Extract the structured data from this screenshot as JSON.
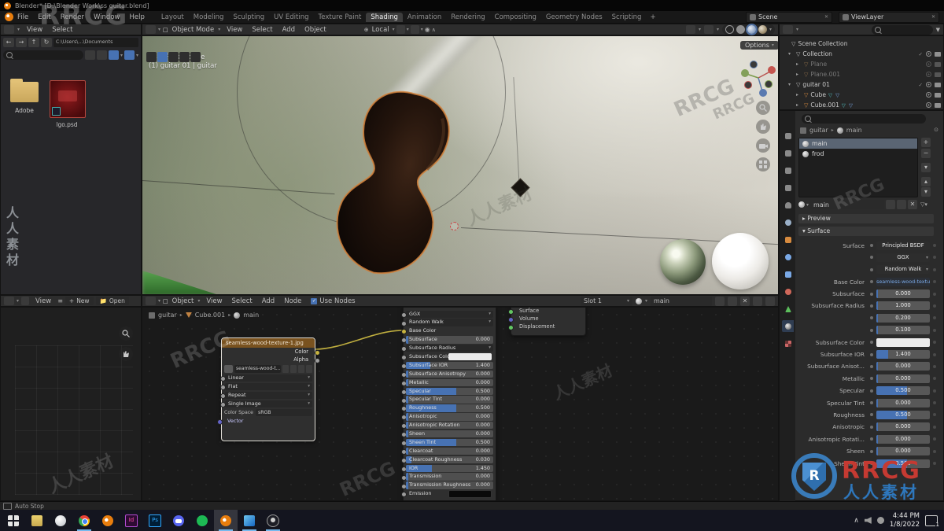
{
  "titlebar": {
    "title": "Blender* [D:\\Blender Work\\ss guitar.blend]"
  },
  "topbar": {
    "menus": [
      {
        "label": "File"
      },
      {
        "label": "Edit"
      },
      {
        "label": "Render"
      },
      {
        "label": "Window"
      },
      {
        "label": "Help"
      }
    ],
    "workspaces": [
      {
        "label": "Layout",
        "cls": ""
      },
      {
        "label": "Modeling",
        "cls": ""
      },
      {
        "label": "Sculpting",
        "cls": ""
      },
      {
        "label": "UV Editing",
        "cls": ""
      },
      {
        "label": "Texture Paint",
        "cls": ""
      },
      {
        "label": "Shading",
        "cls": "active"
      },
      {
        "label": "Animation",
        "cls": ""
      },
      {
        "label": "Rendering",
        "cls": ""
      },
      {
        "label": "Compositing",
        "cls": ""
      },
      {
        "label": "Geometry Nodes",
        "cls": ""
      },
      {
        "label": "Scripting",
        "cls": ""
      }
    ],
    "new_workspace": "+",
    "scene": "Scene",
    "view_layer": "ViewLayer"
  },
  "file_browser": {
    "menus": [
      {
        "label": "View"
      },
      {
        "label": "Select"
      }
    ],
    "path": "C:\\Users\\...\\Documents",
    "items": [
      {
        "label": "Adobe"
      },
      {
        "label": "lgo.psd"
      }
    ]
  },
  "image_editor": {
    "view": "View",
    "new_button": "New",
    "open_button": "Open"
  },
  "viewport": {
    "mode": "Object Mode",
    "menus": [
      {
        "label": "View"
      },
      {
        "label": "Select"
      },
      {
        "label": "Add"
      },
      {
        "label": "Object"
      }
    ],
    "orientation": "Local",
    "persp": "User Perspective",
    "object_info": "(1) guitar 01 | guitar",
    "options": "Options"
  },
  "shader_editor": {
    "type": "Object",
    "menus": [
      {
        "label": "View"
      },
      {
        "label": "Select"
      },
      {
        "label": "Add"
      },
      {
        "label": "Node"
      }
    ],
    "use_nodes": "Use Nodes",
    "slot": "Slot 1",
    "material": "main",
    "breadcrumb": {
      "object": "guitar",
      "mesh": "Cube.001",
      "material": "main"
    },
    "image_node": {
      "title": "seamless-wood-texture-1.jpg",
      "outputs": [
        {
          "label": "Color",
          "cls": ""
        },
        {
          "label": "Alpha",
          "cls": "grey"
        }
      ],
      "image_name": "seamless-wood-t...",
      "dropdowns": [
        {
          "label": "Linear"
        },
        {
          "label": "Flat"
        },
        {
          "label": "Repeat"
        },
        {
          "label": "Single Image"
        }
      ],
      "color_space_label": "Color Space",
      "color_space": "sRGB",
      "vector_label": "Vector"
    },
    "bsdf_node": {
      "rows": [
        {
          "cls": "dropdown",
          "label": "GGX",
          "value": "",
          "fill": "0"
        },
        {
          "cls": "dropdown",
          "label": "Random Walk",
          "value": "",
          "fill": "0"
        },
        {
          "cls": "plain",
          "label": "Base Color",
          "value": "",
          "fill": "0"
        },
        {
          "cls": "slider",
          "label": "Subsurface",
          "value": "0.000",
          "fill": "3%"
        },
        {
          "cls": "dropdown",
          "label": "Subsurface Radius",
          "value": "",
          "fill": "0"
        },
        {
          "cls": "colorw",
          "label": "Subsurface Color",
          "value": "",
          "fill": "0"
        },
        {
          "cls": "slider",
          "label": "Subsurface IOR",
          "value": "1.400",
          "fill": "28%"
        },
        {
          "cls": "slider",
          "label": "Subsurface Anisotropy",
          "value": "0.000",
          "fill": "3%"
        },
        {
          "cls": "slider",
          "label": "Metallic",
          "value": "0.000",
          "fill": "3%"
        },
        {
          "cls": "slider",
          "label": "Specular",
          "value": "0.500",
          "fill": "58%"
        },
        {
          "cls": "slider",
          "label": "Specular Tint",
          "value": "0.000",
          "fill": "3%"
        },
        {
          "cls": "slider",
          "label": "Roughness",
          "value": "0.500",
          "fill": "58%"
        },
        {
          "cls": "slider",
          "label": "Anisotropic",
          "value": "0.000",
          "fill": "3%"
        },
        {
          "cls": "slider",
          "label": "Anisotropic Rotation",
          "value": "0.000",
          "fill": "3%"
        },
        {
          "cls": "slider",
          "label": "Sheen",
          "value": "0.000",
          "fill": "3%"
        },
        {
          "cls": "slider",
          "label": "Sheen Tint",
          "value": "0.500",
          "fill": "58%"
        },
        {
          "cls": "slider",
          "label": "Clearcoat",
          "value": "0.000",
          "fill": "3%"
        },
        {
          "cls": "slider",
          "label": "Clearcoat Roughness",
          "value": "0.030",
          "fill": "6%"
        },
        {
          "cls": "slider",
          "label": "IOR",
          "value": "1.450",
          "fill": "30%"
        },
        {
          "cls": "slider",
          "label": "Transmission",
          "value": "0.000",
          "fill": "3%"
        },
        {
          "cls": "slider",
          "label": "Transmission Roughness",
          "value": "0.000",
          "fill": "3%"
        },
        {
          "cls": "colorb",
          "label": "Emission",
          "value": "",
          "fill": "0"
        }
      ]
    },
    "output_node": {
      "inputs": [
        {
          "label": "Surface"
        },
        {
          "label": "Volume"
        },
        {
          "label": "Displacement"
        }
      ]
    }
  },
  "outliner": {
    "rows": [
      {
        "label": "Scene Collection",
        "arrow": "",
        "icon": "icon-scene",
        "cls": "",
        "tg": "",
        "style": "padding-left:5px"
      },
      {
        "label": "Collection",
        "arrow": "▾",
        "icon": "icon-col",
        "cls": "tg-cec",
        "tg": "",
        "style": "padding-left:11px"
      },
      {
        "label": "Plane",
        "arrow": "▸",
        "icon": "icon-mesh",
        "cls": "dim tg-ec",
        "tg": "",
        "style": "padding-left:21px"
      },
      {
        "label": "Plane.001",
        "arrow": "▸",
        "icon": "icon-mesh",
        "cls": "dim tg-ec",
        "tg": "",
        "style": "padding-left:21px"
      },
      {
        "label": "guitar 01",
        "arrow": "▾",
        "icon": "icon-col",
        "cls": "tg-cec",
        "tg": "",
        "style": "padding-left:11px"
      },
      {
        "label": "Cube",
        "arrow": "▸",
        "icon": "icon-mesh",
        "cls": "has-extra tg-ec",
        "tg": "",
        "style": "padding-left:21px"
      },
      {
        "label": "Cube.001",
        "arrow": "▸",
        "icon": "icon-mesh",
        "cls": "has-extra tg-ec",
        "tg": "",
        "style": "padding-left:21px"
      }
    ]
  },
  "properties": {
    "tabs": [
      {
        "cls": "pt-tool"
      },
      {
        "cls": "pt-render"
      },
      {
        "cls": "pt-output"
      },
      {
        "cls": "pt-viewlayer"
      },
      {
        "cls": "pt-scene"
      },
      {
        "cls": "pt-world"
      },
      {
        "cls": "pt-object"
      },
      {
        "cls": "pt-modifier"
      },
      {
        "cls": "pt-particles"
      },
      {
        "cls": "pt-physics"
      },
      {
        "cls": "pt-data"
      },
      {
        "cls": "pt-material active"
      },
      {
        "cls": "pt-texture"
      }
    ],
    "breadcrumb": {
      "object": "guitar",
      "material": "main"
    },
    "slots": [
      {
        "label": "main",
        "cls": "selected"
      },
      {
        "label": "frod",
        "cls": ""
      }
    ],
    "name_field": "main",
    "preview_section": "Preview",
    "surface_section": "Surface",
    "rows": [
      {
        "cls": "pbutton",
        "label": "Surface",
        "value": "Principled BSDF",
        "fill": "0"
      },
      {
        "cls": "pdrop",
        "label": "",
        "value": "GGX",
        "fill": "0"
      },
      {
        "cls": "pdrop",
        "label": "",
        "value": "Random Walk",
        "fill": "0"
      },
      {
        "cls": "plink",
        "label": "Base Color",
        "value": "seamless-wood-texture...",
        "fill": "0"
      },
      {
        "cls": "pslider",
        "label": "Subsurface",
        "value": "0.000",
        "fill": "3%"
      },
      {
        "cls": "pslider",
        "label": "Subsurface Radius",
        "value": "1.000",
        "fill": "3%"
      },
      {
        "cls": "pslider",
        "label": "",
        "value": "0.200",
        "fill": "3%"
      },
      {
        "cls": "pslider",
        "label": "",
        "value": "0.100",
        "fill": "3%"
      },
      {
        "cls": "pcolorw",
        "label": "Subsurface Color",
        "value": "",
        "fill": "0"
      },
      {
        "cls": "pslider",
        "label": "Subsurface IOR",
        "value": "1.400",
        "fill": "22%"
      },
      {
        "cls": "pslider",
        "label": "Subsurface Anisot...",
        "value": "0.000",
        "fill": "3%"
      },
      {
        "cls": "pslider",
        "label": "Metallic",
        "value": "0.000",
        "fill": "3%"
      },
      {
        "cls": "pslider",
        "label": "Specular",
        "value": "0.500",
        "fill": "58%"
      },
      {
        "cls": "pslider",
        "label": "Specular Tint",
        "value": "0.000",
        "fill": "3%"
      },
      {
        "cls": "pslider",
        "label": "Roughness",
        "value": "0.500",
        "fill": "58%"
      },
      {
        "cls": "pslider",
        "label": "Anisotropic",
        "value": "0.000",
        "fill": "3%"
      },
      {
        "cls": "pslider",
        "label": "Anisotropic Rotati...",
        "value": "0.000",
        "fill": "3%"
      },
      {
        "cls": "pslider",
        "label": "Sheen",
        "value": "0.000",
        "fill": "3%"
      },
      {
        "cls": "pslider",
        "label": "Sheen Tint",
        "value": "0.500",
        "fill": "58%"
      }
    ]
  },
  "statusbar": {
    "left": "Auto Stop"
  },
  "taskbar": {
    "icons": [
      {
        "name": "start",
        "cls": "tb-start",
        "label": ""
      },
      {
        "name": "file-explorer",
        "cls": "tb-explorer",
        "label": ""
      },
      {
        "name": "browser",
        "cls": "tb-circle-light",
        "label": ""
      },
      {
        "name": "chrome",
        "cls": "tb-chrome running",
        "label": ""
      },
      {
        "name": "blender",
        "cls": "tb-blender",
        "label": ""
      },
      {
        "name": "indesign",
        "cls": "tb-indesign",
        "label": "Id"
      },
      {
        "name": "photoshop",
        "cls": "tb-photoshop",
        "label": "Ps"
      },
      {
        "name": "discord",
        "cls": "tb-discord",
        "label": ""
      },
      {
        "name": "spotify",
        "cls": "tb-spotify",
        "label": ""
      },
      {
        "name": "blender-active",
        "cls": "tb-blender focused running",
        "label": ""
      },
      {
        "name": "photos",
        "cls": "tb-photos running",
        "label": ""
      },
      {
        "name": "obs",
        "cls": "tb-obs running",
        "label": ""
      }
    ],
    "time": "4:44 PM",
    "date": "1/8/2022",
    "badge": "1"
  },
  "watermarks": {
    "brand": {
      "name": "RRCG",
      "cn": "人人素材",
      "letter": "R"
    },
    "items": [
      {
        "text": "RRCG",
        "style": "left:50px;top:0px;font-size:34px;color:#9a9a9a;opacity:.45;letter-spacing:2px"
      },
      {
        "text": "人人素材",
        "style": "left:2px;top:262px;writing-mode:vertical-rl;font-size:16px;color:#cfd6dd;opacity:.6;letter-spacing:4px"
      },
      {
        "text": "RRCG",
        "style": "left:215px;top:430px;font-size:26px;color:#ffffff;opacity:.16;transform:rotate(-24deg)"
      },
      {
        "text": "RRCG",
        "style": "left:855px;top:110px;font-size:26px;color:#4a4a4a;opacity:.28;transform:rotate(-24deg)"
      },
      {
        "text": "人人素材",
        "style": "left:58px;top:585px;font-size:22px;color:#ffffff;opacity:.15;transform:rotate(-24deg)"
      },
      {
        "text": "RRCG",
        "style": "left:430px;top:595px;font-size:24px;color:#ffffff;opacity:.13;transform:rotate(-24deg)"
      },
      {
        "text": "人人素材",
        "style": "left:590px;top:245px;font-size:22px;color:#3c4038;opacity:.18;transform:rotate(-24deg)"
      },
      {
        "text": "RRCG",
        "style": "left:1058px;top:235px;font-size:22px;color:#ffffff;opacity:.14;transform:rotate(-24deg)"
      },
      {
        "text": "人人素材",
        "style": "left:700px;top:470px;font-size:20px;color:#ffffff;opacity:.12;transform:rotate(-24deg)"
      },
      {
        "text": "RRCG",
        "style": "left:905px;top:125px;font-size:18px;color:#555;opacity:.3;transform:rotate(-24deg)"
      }
    ]
  }
}
